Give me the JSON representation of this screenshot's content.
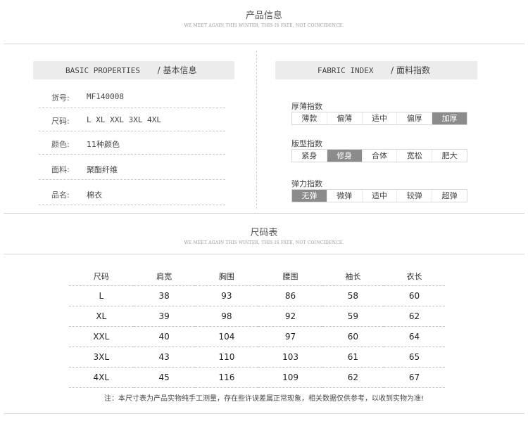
{
  "product_section": {
    "title": "产品信息",
    "subtitle": "WE MEET AGAIN THIS WINTER, THIS IS FATE, NOT COINCIDENCE."
  },
  "basic": {
    "header_en": "BASIC PROPERTIES",
    "header_cn": "/ 基本信息",
    "rows": [
      {
        "label": "货号:",
        "value": "MF140008"
      },
      {
        "label": "尺码:",
        "value": "L XL XXL 3XL 4XL"
      },
      {
        "label": "颜色:",
        "value": "11种颜色"
      },
      {
        "label": "面料:",
        "value": "聚酯纤维"
      },
      {
        "label": "品名:",
        "value": "棉衣"
      }
    ]
  },
  "fabric": {
    "header_en": "FABRIC INDEX",
    "header_cn": "/ 面料指数",
    "groups": [
      {
        "label": "厚薄指数",
        "options": [
          "薄款",
          "偏薄",
          "适中",
          "偏厚",
          "加厚"
        ],
        "selected": "加厚"
      },
      {
        "label": "版型指数",
        "options": [
          "紧身",
          "修身",
          "合体",
          "宽松",
          "肥大"
        ],
        "selected": "修身"
      },
      {
        "label": "弹力指数",
        "options": [
          "无弹",
          "微弹",
          "适中",
          "较弹",
          "超弹"
        ],
        "selected": "无弹"
      }
    ]
  },
  "size_section": {
    "title": "尺码表",
    "subtitle": "WE MEET AGAIN THIS WINTER, THIS IS FATE, NOT COINCIDENCE.",
    "headers": [
      "尺码",
      "肩宽",
      "胸围",
      "腰围",
      "袖长",
      "衣长"
    ],
    "rows": [
      [
        "L",
        "38",
        "93",
        "86",
        "58",
        "60"
      ],
      [
        "XL",
        "39",
        "98",
        "92",
        "59",
        "62"
      ],
      [
        "XXL",
        "40",
        "104",
        "97",
        "60",
        "64"
      ],
      [
        "3XL",
        "43",
        "110",
        "103",
        "61",
        "65"
      ],
      [
        "4XL",
        "45",
        "116",
        "109",
        "62",
        "67"
      ]
    ],
    "note": "注：本尺寸表为产品实物纯手工测量，存在些许误差属正常现象，相关数据仅供参考，以收到实物为准!"
  }
}
